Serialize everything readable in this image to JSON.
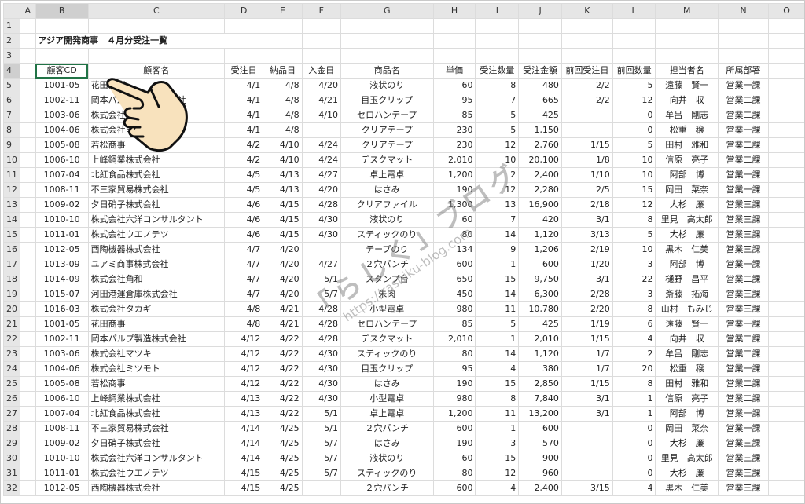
{
  "column_headers": [
    "A",
    "B",
    "C",
    "D",
    "E",
    "F",
    "G",
    "H",
    "I",
    "J",
    "K",
    "L",
    "M",
    "N",
    "O"
  ],
  "title": "アジア開発商事　４月分受注一覧",
  "table_headers": [
    "顧客CD",
    "顧客名",
    "受注日",
    "納品日",
    "入金日",
    "商品名",
    "単価",
    "受注数量",
    "受注金額",
    "前回受注日",
    "前回数量",
    "担当者名",
    "所属部署"
  ],
  "rows": [
    [
      "1001-05",
      "花田商事",
      "4/1",
      "4/8",
      "4/20",
      "液状のり",
      "60",
      "8",
      "480",
      "2/2",
      "5",
      "遠藤　賢一",
      "営業一課"
    ],
    [
      "1002-11",
      "岡本パルプ製造株式会社",
      "4/1",
      "4/8",
      "4/21",
      "目玉クリップ",
      "95",
      "7",
      "665",
      "2/2",
      "12",
      "向井　収",
      "営業二課"
    ],
    [
      "1003-06",
      "株式会社マツキ",
      "4/1",
      "4/8",
      "4/10",
      "セロハンテープ",
      "85",
      "5",
      "425",
      "",
      "0",
      "牟呂　剛志",
      "営業二課"
    ],
    [
      "1004-06",
      "株式会社ミツモト",
      "4/1",
      "4/8",
      "",
      "クリアテープ",
      "230",
      "5",
      "1,150",
      "",
      "0",
      "松重　穣",
      "営業一課"
    ],
    [
      "1005-08",
      "若松商事",
      "4/2",
      "4/10",
      "4/24",
      "クリアテープ",
      "230",
      "12",
      "2,760",
      "1/15",
      "5",
      "田村　雅和",
      "営業二課"
    ],
    [
      "1006-10",
      "上峰鋼業株式会社",
      "4/2",
      "4/10",
      "4/24",
      "デスクマット",
      "2,010",
      "10",
      "20,100",
      "1/8",
      "10",
      "信原　亮子",
      "営業二課"
    ],
    [
      "1007-04",
      "北紅食品株式会社",
      "4/5",
      "4/13",
      "4/27",
      "卓上電卓",
      "1,200",
      "2",
      "2,400",
      "1/10",
      "10",
      "阿部　博",
      "営業一課"
    ],
    [
      "1008-11",
      "不三家貿易株式会社",
      "4/5",
      "4/13",
      "4/20",
      "はさみ",
      "190",
      "12",
      "2,280",
      "2/5",
      "15",
      "岡田　菜奈",
      "営業一課"
    ],
    [
      "1009-02",
      "夕日硝子株式会社",
      "4/6",
      "4/15",
      "4/28",
      "クリアファイル",
      "1,300",
      "13",
      "16,900",
      "2/18",
      "12",
      "大杉　廉",
      "営業三課"
    ],
    [
      "1010-10",
      "株式会社六洋コンサルタント",
      "4/6",
      "4/15",
      "4/30",
      "液状のり",
      "60",
      "7",
      "420",
      "3/1",
      "8",
      "里見　高太郎",
      "営業三課"
    ],
    [
      "1011-01",
      "株式会社ウエノテツ",
      "4/6",
      "4/15",
      "4/30",
      "スティックのり",
      "80",
      "14",
      "1,120",
      "3/13",
      "5",
      "大杉　廉",
      "営業三課"
    ],
    [
      "1012-05",
      "西陶機器株式会社",
      "4/7",
      "4/20",
      "",
      "テープのり",
      "134",
      "9",
      "1,206",
      "2/19",
      "10",
      "黒木　仁美",
      "営業三課"
    ],
    [
      "1013-09",
      "ユアミ商事株式会社",
      "4/7",
      "4/20",
      "4/27",
      "２穴パンチ",
      "600",
      "1",
      "600",
      "1/20",
      "3",
      "阿部　博",
      "営業一課"
    ],
    [
      "1014-09",
      "株式会社角和",
      "4/7",
      "4/20",
      "5/1",
      "スタンプ台",
      "650",
      "15",
      "9,750",
      "3/1",
      "22",
      "樋野　昌平",
      "営業二課"
    ],
    [
      "1015-07",
      "河田港運倉庫株式会社",
      "4/7",
      "4/20",
      "5/7",
      "朱肉",
      "450",
      "14",
      "6,300",
      "2/28",
      "3",
      "斎藤　拓海",
      "営業三課"
    ],
    [
      "1016-03",
      "株式会社タカギ",
      "4/8",
      "4/21",
      "4/28",
      "小型電卓",
      "980",
      "11",
      "10,780",
      "2/20",
      "8",
      "山村　もみじ",
      "営業三課"
    ],
    [
      "1001-05",
      "花田商事",
      "4/8",
      "4/21",
      "4/28",
      "セロハンテープ",
      "85",
      "5",
      "425",
      "1/19",
      "6",
      "遠藤　賢一",
      "営業一課"
    ],
    [
      "1002-11",
      "岡本パルプ製造株式会社",
      "4/12",
      "4/22",
      "4/28",
      "デスクマット",
      "2,010",
      "1",
      "2,010",
      "1/15",
      "4",
      "向井　収",
      "営業二課"
    ],
    [
      "1003-06",
      "株式会社マツキ",
      "4/12",
      "4/22",
      "4/30",
      "スティックのり",
      "80",
      "14",
      "1,120",
      "1/7",
      "2",
      "牟呂　剛志",
      "営業二課"
    ],
    [
      "1004-06",
      "株式会社ミツモト",
      "4/12",
      "4/22",
      "4/30",
      "目玉クリップ",
      "95",
      "4",
      "380",
      "1/7",
      "20",
      "松重　穣",
      "営業一課"
    ],
    [
      "1005-08",
      "若松商事",
      "4/12",
      "4/22",
      "4/30",
      "はさみ",
      "190",
      "15",
      "2,850",
      "1/15",
      "8",
      "田村　雅和",
      "営業二課"
    ],
    [
      "1006-10",
      "上峰鋼業株式会社",
      "4/13",
      "4/22",
      "4/30",
      "小型電卓",
      "980",
      "8",
      "7,840",
      "3/1",
      "1",
      "信原　亮子",
      "営業二課"
    ],
    [
      "1007-04",
      "北紅食品株式会社",
      "4/13",
      "4/22",
      "5/1",
      "卓上電卓",
      "1,200",
      "11",
      "13,200",
      "3/1",
      "1",
      "阿部　博",
      "営業一課"
    ],
    [
      "1008-11",
      "不三家貿易株式会社",
      "4/14",
      "4/25",
      "5/1",
      "２穴パンチ",
      "600",
      "1",
      "600",
      "",
      "0",
      "岡田　菜奈",
      "営業一課"
    ],
    [
      "1009-02",
      "夕日硝子株式会社",
      "4/14",
      "4/25",
      "5/7",
      "はさみ",
      "190",
      "3",
      "570",
      "",
      "0",
      "大杉　廉",
      "営業三課"
    ],
    [
      "1010-10",
      "株式会社六洋コンサルタント",
      "4/14",
      "4/25",
      "5/7",
      "液状のり",
      "60",
      "15",
      "900",
      "",
      "0",
      "里見　高太郎",
      "営業三課"
    ],
    [
      "1011-01",
      "株式会社ウエノテツ",
      "4/15",
      "4/25",
      "5/7",
      "スティックのり",
      "80",
      "12",
      "960",
      "",
      "0",
      "大杉　廉",
      "営業三課"
    ],
    [
      "1012-05",
      "西陶機器株式会社",
      "4/15",
      "4/25",
      "",
      "２穴パンチ",
      "600",
      "4",
      "2,400",
      "3/15",
      "4",
      "黒木　仁美",
      "営業三課"
    ]
  ],
  "watermark": {
    "main": "「らしく」ブログ",
    "url": "https://rashiku-blog.com"
  }
}
